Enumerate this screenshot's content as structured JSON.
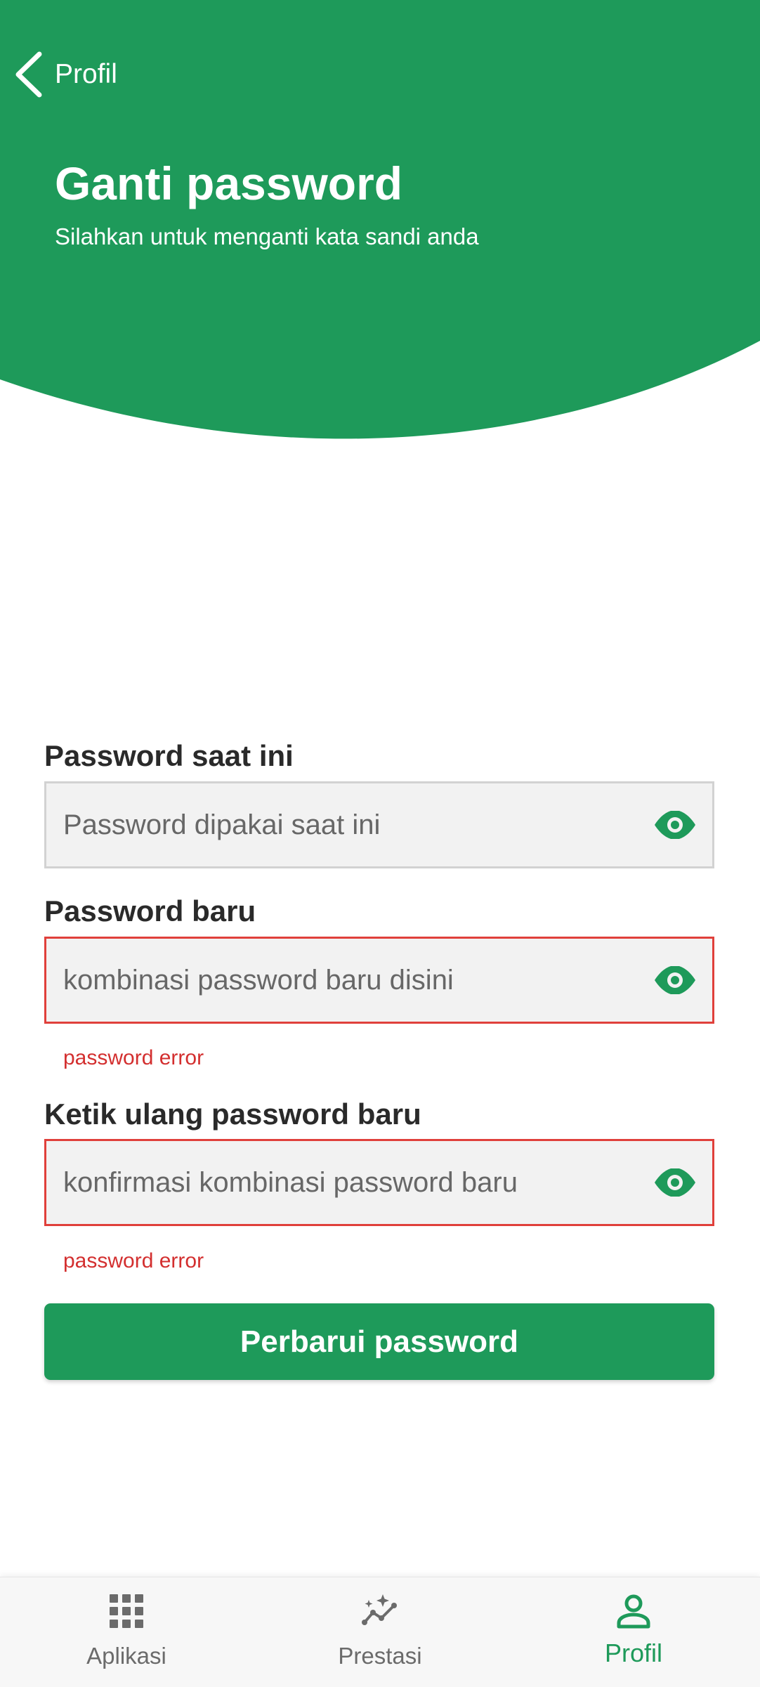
{
  "colors": {
    "primary": "#1e9a5a",
    "error": "#d32f2f",
    "error_border": "#e0403b",
    "input_bg": "#f2f2f2"
  },
  "header": {
    "back_label": "Profil",
    "title": "Ganti password",
    "subtitle": "Silahkan untuk menganti kata sandi anda"
  },
  "form": {
    "current_password": {
      "label": "Password saat ini",
      "placeholder": "Password dipakai saat ini",
      "value": "",
      "error": ""
    },
    "new_password": {
      "label": "Password baru",
      "placeholder": "kombinasi password baru disini",
      "value": "",
      "error": "password error"
    },
    "confirm_password": {
      "label": "Ketik ulang password baru",
      "placeholder": "konfirmasi kombinasi password baru",
      "value": "",
      "error": "password error"
    },
    "submit_label": "Perbarui password"
  },
  "bottom_nav": {
    "items": [
      {
        "label": "Aplikasi",
        "icon": "apps-grid-icon",
        "active": false
      },
      {
        "label": "Prestasi",
        "icon": "trend-sparkle-icon",
        "active": false
      },
      {
        "label": "Profil",
        "icon": "person-icon",
        "active": true
      }
    ]
  }
}
